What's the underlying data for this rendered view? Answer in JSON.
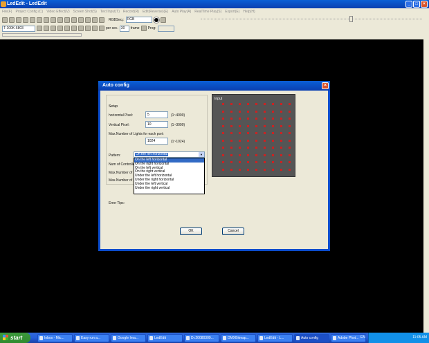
{
  "app": {
    "title": "LedEdit - LedEdit"
  },
  "menu": [
    "File(F)",
    "Project Config (C)",
    "Video Effect(V)",
    "Screen Shot(S)",
    "Text Input(T)",
    "Record(R)",
    "Edit(Reverse)(E)",
    "Auto Play(A)",
    "RealTime Play(S)",
    "Export(E)",
    "Help(H)"
  ],
  "toolbar": {
    "rgb_label": "RGBSeq.:",
    "rgb_value": "RGB",
    "device_value": "T-100K-6803",
    "per_sec_label": "per sec.",
    "per_sec_value": "30",
    "frame_label": "frame",
    "prog_label": "Prog:"
  },
  "dialog": {
    "title": "Auto config",
    "setup_legend": "Setup",
    "horizontal_label": "horizontal Pixel:",
    "horizontal_value": "5",
    "horizontal_range": "(1~4000)",
    "vertical_label": "Vertical Pixel:",
    "vertical_value": "10",
    "vertical_range": "(1~3000)",
    "maxlights_label": "Max.Number of Lights for each port:",
    "maxlights_value": "1024",
    "maxlights_range": "(1~1024)",
    "pattern_label": "Pattern:",
    "pattern_selected": "On the left horizontal",
    "pattern_options": [
      "On the left horizontal",
      "On the right horizontal",
      "On the left vertical",
      "On the right vertical",
      "Under the left horizontal",
      "Under the right horizontal",
      "Under the left vertical",
      "Under the right vertical"
    ],
    "num_controllers_label": "Num of Controllers:",
    "max_number_label_1": "Max.Number of",
    "max_number_label_2": "Max.Number of",
    "error_label": "Error Tips:",
    "preview_label": "Input",
    "ok_label": "OK",
    "cancel_label": "Cancel"
  },
  "preview_grid": {
    "cols": 9,
    "rows": 10,
    "dot_color": "#cc2222"
  },
  "taskbar": {
    "start_label": "start",
    "tasks": [
      "Inbox - Mic...",
      "Easy run a...",
      "Google Ima...",
      "LedEdit",
      "Dr.20080309...",
      "DMXBitmap...",
      "LedEdit - L...",
      "Auto config",
      "Adobe Phot..."
    ],
    "active_task": 7,
    "lang": "EN",
    "clock": "11:05 AM"
  },
  "colors": {
    "xp_blue": "#0a4ccc",
    "face": "#ece9d8",
    "select": "#316ac5"
  }
}
